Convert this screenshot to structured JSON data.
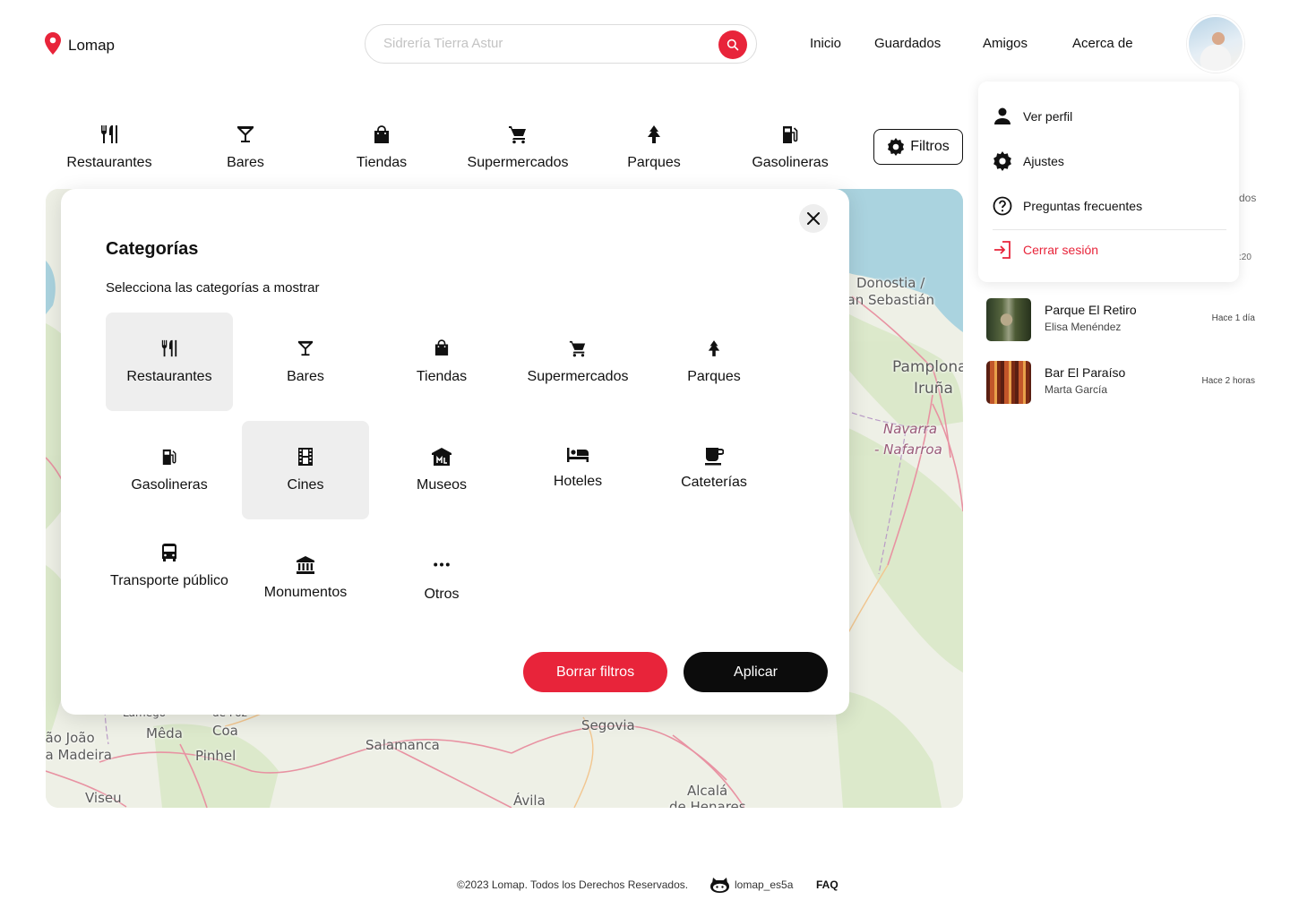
{
  "app": {
    "name": "Lomap",
    "accent": "#e8243a"
  },
  "header": {
    "search_placeholder": "Sidrería Tierra Astur",
    "nav": [
      "Inicio",
      "Guardados",
      "Amigos",
      "Acerca de"
    ]
  },
  "category_bar": {
    "items": [
      {
        "label": "Restaurantes",
        "icon": "restaurant-icon"
      },
      {
        "label": "Bares",
        "icon": "cocktail-icon"
      },
      {
        "label": "Tiendas",
        "icon": "shopping-bag-icon"
      },
      {
        "label": "Supermercados",
        "icon": "shopping-cart-icon"
      },
      {
        "label": "Parques",
        "icon": "tree-icon"
      },
      {
        "label": "Gasolineras",
        "icon": "gas-station-icon"
      }
    ],
    "filters_label": "Filtros"
  },
  "map": {
    "labels": [
      "Donostia /",
      "San Sebastián",
      "Pamplona",
      "Iruña",
      "Navarra",
      "- Nafarroa",
      "Segovia",
      "Salamanca",
      "Ávila",
      "Alcalá",
      "de Henares",
      "Mêda",
      "Coa",
      "Pinhel",
      "Viseu",
      "São João",
      "da Madeira",
      "Lamego",
      "de Foz"
    ]
  },
  "modal": {
    "title": "Categorías",
    "subtitle": "Selecciona las categorías a mostrar",
    "categories": [
      {
        "label": "Restaurantes",
        "icon": "restaurant-icon",
        "selected": true
      },
      {
        "label": "Bares",
        "icon": "cocktail-icon",
        "selected": false
      },
      {
        "label": "Tiendas",
        "icon": "shopping-bag-icon",
        "selected": false
      },
      {
        "label": "Supermercados",
        "icon": "shopping-cart-icon",
        "selected": false
      },
      {
        "label": "Parques",
        "icon": "tree-icon",
        "selected": false
      },
      {
        "label": "Gasolineras",
        "icon": "gas-station-icon",
        "selected": false
      },
      {
        "label": "Cines",
        "icon": "film-icon",
        "selected": true
      },
      {
        "label": "Museos",
        "icon": "museum-icon",
        "selected": false
      },
      {
        "label": "Hoteles",
        "icon": "hotel-bed-icon",
        "selected": false
      },
      {
        "label": "Cateterías",
        "icon": "coffee-icon",
        "selected": false
      },
      {
        "label": "Transporte público",
        "icon": "bus-icon",
        "selected": false
      },
      {
        "label": "Monumentos",
        "icon": "monument-icon",
        "selected": false
      },
      {
        "label": "Otros",
        "icon": "more-dots-icon",
        "selected": false
      }
    ],
    "clear_label": "Borrar filtros",
    "apply_label": "Aplicar"
  },
  "dropdown": {
    "items": [
      {
        "label": "Ver perfil",
        "icon": "person-icon"
      },
      {
        "label": "Ajustes",
        "icon": "gear-icon"
      },
      {
        "label": "Preguntas frecuentes",
        "icon": "help-circle-icon"
      },
      {
        "label": "Cerrar sesión",
        "icon": "logout-icon"
      }
    ]
  },
  "feed": {
    "partial_texts": [
      "dos",
      ":20"
    ],
    "items": [
      {
        "title": "Parque El Retiro",
        "user": "Elisa Menéndez",
        "time": "Hace 1 día"
      },
      {
        "title": "Bar El Paraíso",
        "user": "Marta García",
        "time": "Hace 2 horas"
      }
    ]
  },
  "footer": {
    "copyright": "©2023 Lomap. Todos los Derechos Reservados.",
    "github": "lomap_es5a",
    "faq": "FAQ"
  }
}
